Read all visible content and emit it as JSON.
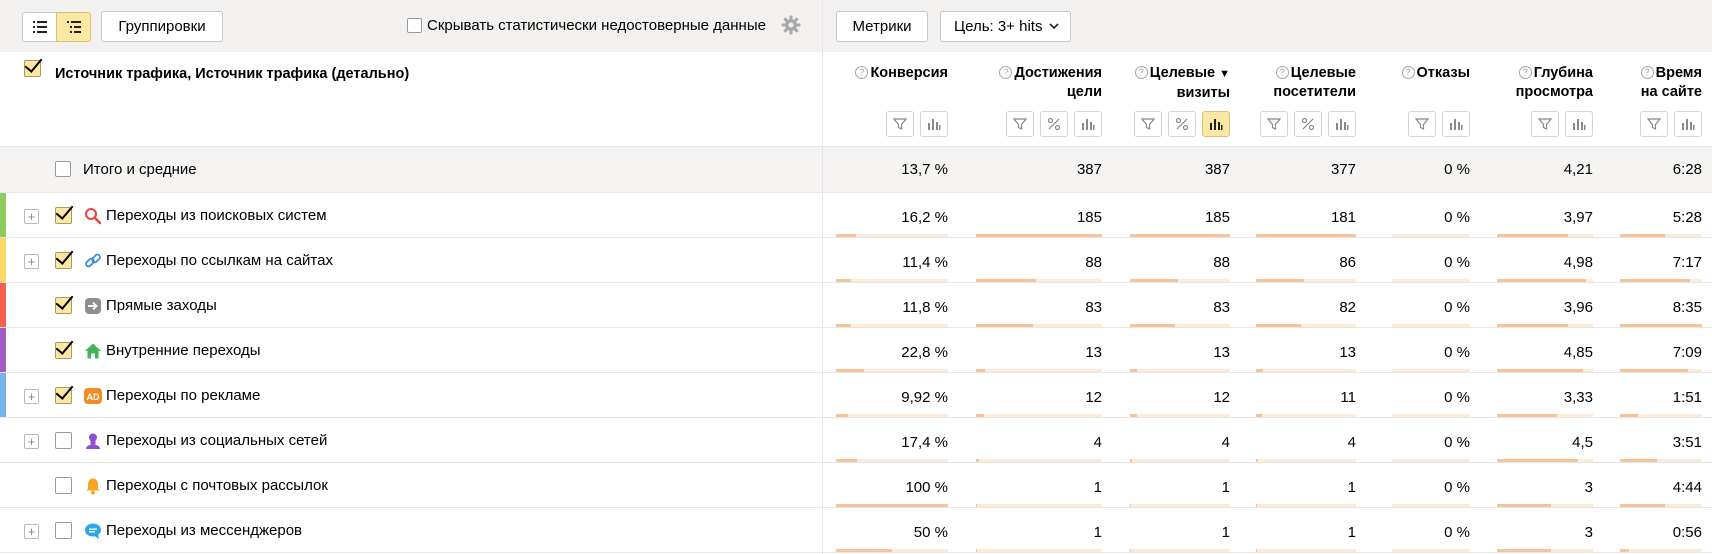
{
  "toolbar": {
    "groupings_label": "Группировки",
    "hide_unreliable_label": "Скрывать статистически недостоверные данные",
    "metrics_label": "Метрики",
    "goal_label": "Цель: 3+ hits"
  },
  "table": {
    "dimension_title": "Источник трафика, Источник трафика (детально)",
    "columns": [
      {
        "line1": "Конверсия",
        "line2": ""
      },
      {
        "line1": "Достижения",
        "line2": "цели"
      },
      {
        "line1": "Целевые",
        "line2": "визиты",
        "sort": "▼"
      },
      {
        "line1": "Целевые",
        "line2": "посетители"
      },
      {
        "line1": "Отказы",
        "line2": ""
      },
      {
        "line1": "Глубина",
        "line2": "просмотра"
      },
      {
        "line1": "Время",
        "line2": "на сайте"
      }
    ],
    "total": {
      "label": "Итого и средние",
      "values": [
        "13,7 %",
        "387",
        "387",
        "377",
        "0 %",
        "4,21",
        "6:28"
      ]
    },
    "rows": [
      {
        "label": "Переходы из поисковых систем",
        "icon": "search-icon",
        "color": "#8ccc5f",
        "expandable": true,
        "checked": true,
        "values": [
          "16,2 %",
          "185",
          "185",
          "181",
          "0 %",
          "3,97",
          "5:28"
        ],
        "bars": [
          0.18,
          1.0,
          1.0,
          1.0,
          0,
          0.74,
          0.55
        ]
      },
      {
        "label": "Переходы по ссылкам на сайтах",
        "icon": "link-icon",
        "color": "#fbd763",
        "expandable": true,
        "checked": true,
        "values": [
          "11,4 %",
          "88",
          "88",
          "86",
          "0 %",
          "4,98",
          "7:17"
        ],
        "bars": [
          0.13,
          0.48,
          0.48,
          0.48,
          0,
          0.93,
          0.85
        ]
      },
      {
        "label": "Прямые заходы",
        "icon": "direct-entry-icon",
        "color": "#f4624c",
        "expandable": false,
        "checked": true,
        "values": [
          "11,8 %",
          "83",
          "83",
          "82",
          "0 %",
          "3,96",
          "8:35"
        ],
        "bars": [
          0.13,
          0.45,
          0.45,
          0.45,
          0,
          0.74,
          1.0
        ]
      },
      {
        "label": "Внутренние переходы",
        "icon": "home-icon",
        "color": "#a35bc5",
        "expandable": false,
        "checked": true,
        "values": [
          "22,8 %",
          "13",
          "13",
          "13",
          "0 %",
          "4,85",
          "7:09"
        ],
        "bars": [
          0.25,
          0.07,
          0.07,
          0.07,
          0,
          0.9,
          0.83
        ]
      },
      {
        "label": "Переходы по рекламе",
        "icon": "ad-icon",
        "color": "#77b4ec",
        "expandable": true,
        "checked": true,
        "values": [
          "9,92 %",
          "12",
          "12",
          "11",
          "0 %",
          "3,33",
          "1:51"
        ],
        "bars": [
          0.11,
          0.065,
          0.065,
          0.06,
          0,
          0.62,
          0.22
        ]
      },
      {
        "label": "Переходы из социальных сетей",
        "icon": "social-icon",
        "color": "",
        "expandable": true,
        "checked": false,
        "values": [
          "17,4 %",
          "4",
          "4",
          "4",
          "0 %",
          "4,5",
          "3:51"
        ],
        "bars": [
          0.19,
          0.02,
          0.02,
          0.02,
          0,
          0.84,
          0.45
        ]
      },
      {
        "label": "Переходы с почтовых рассылок",
        "icon": "bell-icon",
        "color": "",
        "expandable": false,
        "checked": false,
        "values": [
          "100 %",
          "1",
          "1",
          "1",
          "0 %",
          "3",
          "4:44"
        ],
        "bars": [
          1.0,
          0.005,
          0.005,
          0.005,
          0,
          0.56,
          0.55
        ]
      },
      {
        "label": "Переходы из мессенджеров",
        "icon": "messenger-icon",
        "color": "",
        "expandable": true,
        "checked": false,
        "values": [
          "50 %",
          "1",
          "1",
          "1",
          "0 %",
          "3",
          "0:56"
        ],
        "bars": [
          0.5,
          0.005,
          0.005,
          0.005,
          0,
          0.56,
          0.11
        ]
      }
    ]
  }
}
